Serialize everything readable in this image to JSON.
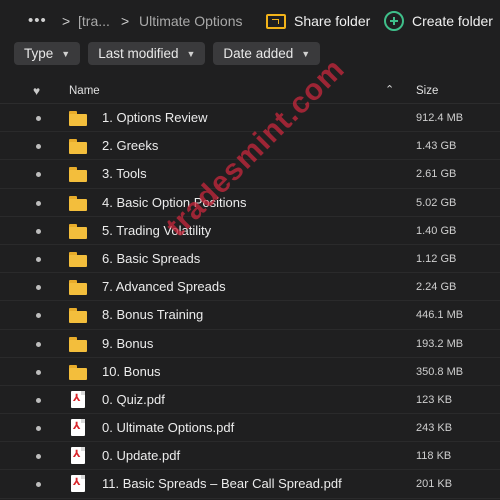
{
  "breadcrumb": {
    "more": "•••",
    "sep1": ">",
    "parent": "[tra...",
    "sep2": ">",
    "current": "Ultimate Options"
  },
  "actions": {
    "share_label": "Share folder",
    "create_label": "Create folder",
    "share_icon": "share-folder-icon",
    "create_icon": "plus-circle-icon"
  },
  "filters": [
    {
      "label": "Type"
    },
    {
      "label": "Last modified"
    },
    {
      "label": "Date added"
    }
  ],
  "table_header": {
    "fav_icon": "heart-icon",
    "name": "Name",
    "sort_icon": "chevron-up-icon",
    "size": "Size"
  },
  "files": [
    {
      "type": "folder",
      "name": "1. Options Review",
      "size": "912.4 MB"
    },
    {
      "type": "folder",
      "name": "2. Greeks",
      "size": "1.43 GB"
    },
    {
      "type": "folder",
      "name": "3. Tools",
      "size": "2.61 GB"
    },
    {
      "type": "folder",
      "name": "4. Basic Option Positions",
      "size": "5.02 GB"
    },
    {
      "type": "folder",
      "name": "5. Trading Volatility",
      "size": "1.40 GB"
    },
    {
      "type": "folder",
      "name": "6. Basic Spreads",
      "size": "1.12 GB"
    },
    {
      "type": "folder",
      "name": "7. Advanced Spreads",
      "size": "2.24 GB"
    },
    {
      "type": "folder",
      "name": "8. Bonus Training",
      "size": "446.1 MB"
    },
    {
      "type": "folder",
      "name": "9. Bonus",
      "size": "193.2 MB"
    },
    {
      "type": "folder",
      "name": "10. Bonus",
      "size": "350.8 MB"
    },
    {
      "type": "pdf",
      "name": "0. Quiz.pdf",
      "size": "123 KB"
    },
    {
      "type": "pdf",
      "name": "0. Ultimate Options.pdf",
      "size": "243 KB"
    },
    {
      "type": "pdf",
      "name": "0. Update.pdf",
      "size": "118 KB"
    },
    {
      "type": "pdf",
      "name": "11. Basic Spreads – Bear Call Spread.pdf",
      "size": "201 KB"
    }
  ],
  "watermark": "tradesmint.com",
  "colors": {
    "folder": "#f3be3c",
    "pdf_accent": "#d8262b",
    "share_accent": "#f2b31a",
    "create_accent": "#3fbf8a",
    "watermark": "#c8283c"
  }
}
